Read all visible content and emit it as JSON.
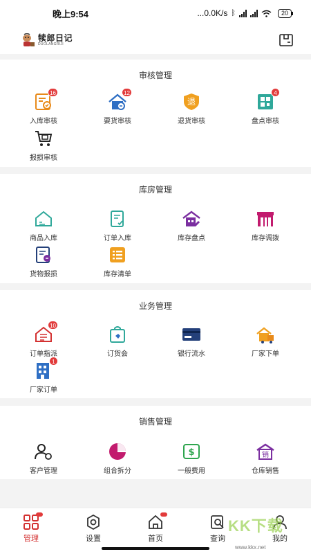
{
  "status_bar": {
    "time": "晚上9:54",
    "network_speed": "...0.0K/s",
    "battery": "20"
  },
  "header": {
    "logo_cn": "犊郎日记",
    "logo_en": "DUOLANGRIJI"
  },
  "sections": [
    {
      "title": "审核管理",
      "items": [
        {
          "label": "入库审核",
          "icon": "inbound-audit-icon",
          "badge": "16"
        },
        {
          "label": "要货审核",
          "icon": "request-audit-icon",
          "badge": "12"
        },
        {
          "label": "退货审核",
          "icon": "return-audit-icon",
          "glyph": "退"
        },
        {
          "label": "盘点审核",
          "icon": "stocktake-audit-icon",
          "badge": "4"
        },
        {
          "label": "报损审核",
          "icon": "loss-audit-icon"
        }
      ]
    },
    {
      "title": "库房管理",
      "items": [
        {
          "label": "商品入库",
          "icon": "goods-inbound-icon"
        },
        {
          "label": "订单入库",
          "icon": "order-inbound-icon"
        },
        {
          "label": "库存盘点",
          "icon": "inventory-check-icon"
        },
        {
          "label": "库存调拨",
          "icon": "inventory-transfer-icon"
        },
        {
          "label": "货物报损",
          "icon": "goods-loss-icon"
        },
        {
          "label": "库存清单",
          "icon": "inventory-list-icon"
        }
      ]
    },
    {
      "title": "业务管理",
      "items": [
        {
          "label": "订单指派",
          "icon": "order-assign-icon",
          "badge": "10"
        },
        {
          "label": "订货会",
          "icon": "order-fair-icon"
        },
        {
          "label": "银行流水",
          "icon": "bank-statement-icon"
        },
        {
          "label": "厂家下单",
          "icon": "factory-order-place-icon"
        },
        {
          "label": "厂家订单",
          "icon": "factory-orders-icon",
          "badge": "1"
        }
      ]
    },
    {
      "title": "销售管理",
      "items": [
        {
          "label": "客户管理",
          "icon": "customer-manage-icon"
        },
        {
          "label": "组合拆分",
          "icon": "combine-split-icon"
        },
        {
          "label": "一般费用",
          "icon": "general-expense-icon"
        },
        {
          "label": "仓库销售",
          "icon": "warehouse-sales-icon",
          "glyph": "销"
        }
      ]
    }
  ],
  "tabbar": [
    {
      "label": "管理",
      "icon": "grid-icon",
      "active": true,
      "badge": true
    },
    {
      "label": "设置",
      "icon": "settings-gear-icon"
    },
    {
      "label": "首页",
      "icon": "home-icon",
      "badge": true
    },
    {
      "label": "查询",
      "icon": "query-icon"
    },
    {
      "label": "我的",
      "icon": "profile-icon"
    }
  ],
  "watermark": {
    "text": "KK下载",
    "url": "www.kkx.net"
  },
  "colors": {
    "accent_red": "#d33131",
    "badge_red": "#e23b3b",
    "orange": "#e88a1a",
    "blue": "#2f6fc4",
    "teal": "#2fa89a",
    "purple": "#7b2fa0",
    "magenta": "#c21b6e",
    "navy": "#24407a",
    "green": "#2ea54e"
  }
}
